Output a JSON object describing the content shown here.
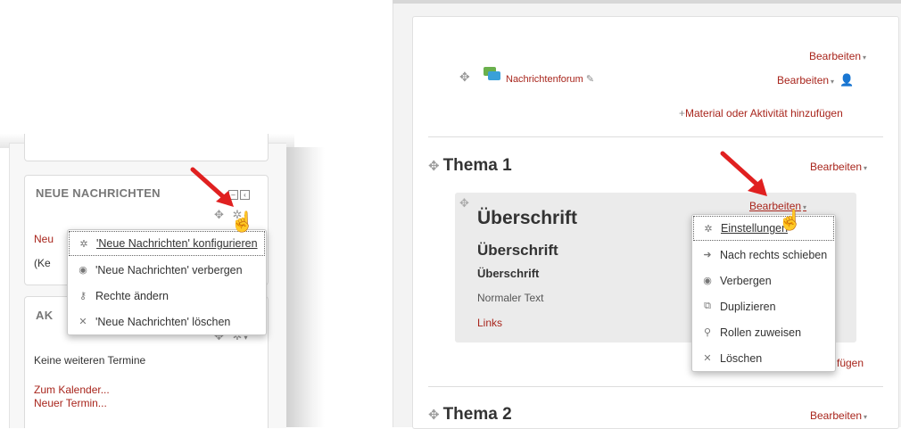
{
  "left": {
    "block1": {
      "title": "NEUE NACHRICHTEN",
      "line1": "Neu",
      "line2": "(Ke"
    },
    "block2": {
      "title": "AK",
      "no_events": "Keine weiteren Termine",
      "calendar_link": "Zum Kalender...",
      "new_event_link": "Neuer Termin..."
    },
    "menu": [
      {
        "icon": "gear-icon",
        "label": "'Neue Nachrichten' konfigurieren",
        "active": true
      },
      {
        "icon": "eye-icon",
        "label": "'Neue Nachrichten' verbergen"
      },
      {
        "icon": "key-icon",
        "label": "Rechte ändern"
      },
      {
        "icon": "close-icon",
        "label": "'Neue Nachrichten' löschen"
      }
    ]
  },
  "right": {
    "top_edit": "Bearbeiten",
    "forum": {
      "name": "Nachrichtenforum",
      "edit": "Bearbeiten"
    },
    "add_activity": "Material oder Aktivität hinzufügen",
    "section1": {
      "title": "Thema 1",
      "edit": "Bearbeiten"
    },
    "label": {
      "edit": "Bearbeiten",
      "h1": "Überschrift",
      "h2": "Überschrift",
      "h3": "Überschrift",
      "normal": "Normaler Text",
      "link": "Links"
    },
    "add_partial": "fügen",
    "section2": {
      "title": "Thema 2",
      "edit": "Bearbeiten"
    },
    "menu": [
      {
        "icon": "gear-icon",
        "label": "Einstellungen",
        "active": true
      },
      {
        "icon": "arrow-right-icon",
        "label": "Nach rechts schieben"
      },
      {
        "icon": "eye-icon",
        "label": "Verbergen"
      },
      {
        "icon": "duplicate-icon",
        "label": "Duplizieren"
      },
      {
        "icon": "assign-roles-icon",
        "label": "Rollen zuweisen"
      },
      {
        "icon": "close-icon",
        "label": "Löschen"
      }
    ]
  },
  "colors": {
    "link": "#a8251c",
    "arrow": "#e02020"
  }
}
